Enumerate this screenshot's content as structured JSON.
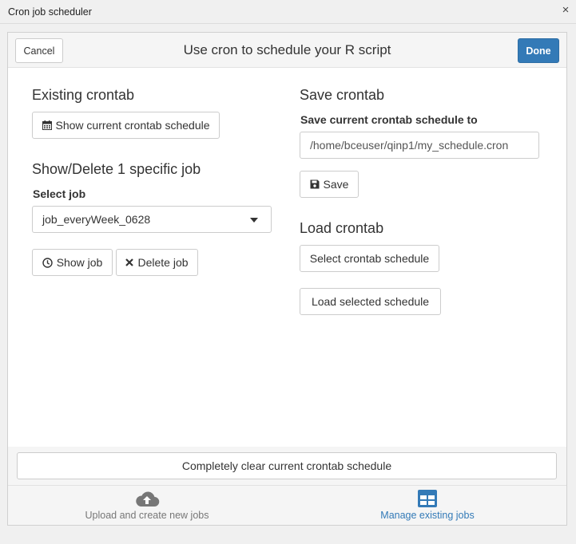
{
  "window": {
    "title": "Cron job scheduler",
    "close_glyph": "×"
  },
  "header": {
    "cancel_label": "Cancel",
    "title": "Use cron to schedule your R script",
    "done_label": "Done"
  },
  "left": {
    "existing_heading": "Existing crontab",
    "show_schedule_label": "Show current crontab schedule",
    "show_delete_heading": "Show/Delete 1 specific job",
    "select_job_label": "Select job",
    "selected_job": "job_everyWeek_0628",
    "show_job_label": "Show job",
    "delete_job_label": "Delete job"
  },
  "right": {
    "save_heading": "Save crontab",
    "save_to_label": "Save current crontab schedule to",
    "save_path_value": "/home/bceuser/qinp1/my_schedule.cron",
    "save_label": "Save",
    "load_heading": "Load crontab",
    "select_schedule_label": "Select crontab schedule",
    "load_selected_label": "Load selected schedule"
  },
  "footer": {
    "clear_label": "Completely clear current crontab schedule"
  },
  "nav": {
    "upload_label": "Upload and create new jobs",
    "manage_label": "Manage existing jobs",
    "inactive_color": "#777777",
    "active_color": "#337ab7"
  },
  "icons": [
    "calendar-icon",
    "clock-icon",
    "close-icon",
    "save-icon",
    "cloud-upload-icon",
    "table-icon"
  ]
}
